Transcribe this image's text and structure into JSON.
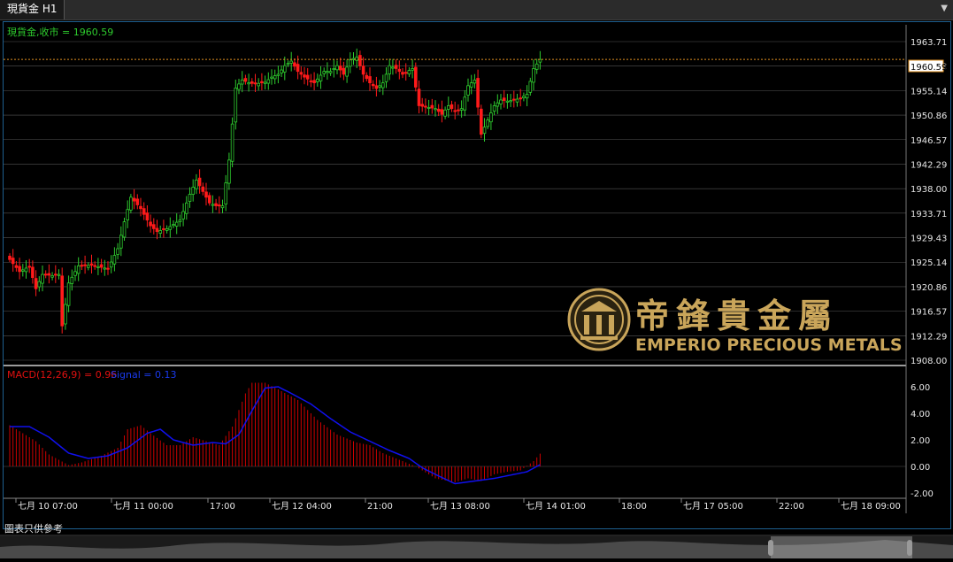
{
  "window": {
    "tab_title": "現貨金 H1"
  },
  "legend": {
    "price_label": "現貨金,收市 = 1960.59",
    "macd_label": "MACD(12,26,9) = 0.96",
    "signal_label": "Signal = 0.13"
  },
  "brand": {
    "cn": "帝鋒貴金屬",
    "en": "EMPERIO PRECIOUS METALS"
  },
  "footer": {
    "note": "圖表只供參考"
  },
  "colors": {
    "bull": "#2ecc2e",
    "bear": "#ff1a1a",
    "macd_hist": "#d00000",
    "signal": "#1010ee",
    "grid": "#555555",
    "last_price_line": "#e09020",
    "gold": "#c9a55a"
  },
  "chart_data": [
    {
      "type": "candlestick",
      "title": "現貨金 H1",
      "y_ticks": [
        "1963.71",
        "1959.43",
        "1955.14",
        "1950.86",
        "1946.57",
        "1942.29",
        "1938.00",
        "1933.71",
        "1929.43",
        "1925.14",
        "1920.86",
        "1916.57",
        "1912.29",
        "1908.00"
      ],
      "ylim": [
        1908.0,
        1963.71
      ],
      "x_tick_labels": [
        "七月 10 07:00",
        "七月 11 00:00",
        "17:00",
        "七月 12 04:00",
        "21:00",
        "七月 13 08:00",
        "七月 14 01:00",
        "18:00",
        "七月 17 05:00",
        "22:00",
        "七月 18 09:00"
      ],
      "last_price": 1960.59,
      "anchors": [
        [
          0,
          1925.6
        ],
        [
          3,
          1923.5
        ],
        [
          6,
          1924.4
        ],
        [
          8,
          1920.5
        ],
        [
          10,
          1923.0
        ],
        [
          13,
          1922.8
        ],
        [
          15,
          1923.0
        ],
        [
          16,
          1914.0
        ],
        [
          18,
          1921.5
        ],
        [
          21,
          1924.5
        ],
        [
          25,
          1924.6
        ],
        [
          30,
          1924.0
        ],
        [
          33,
          1927.5
        ],
        [
          35,
          1932.2
        ],
        [
          37,
          1936.5
        ],
        [
          40,
          1934.5
        ],
        [
          43,
          1931.5
        ],
        [
          45,
          1930.5
        ],
        [
          48,
          1931.0
        ],
        [
          52,
          1932.5
        ],
        [
          55,
          1937.0
        ],
        [
          57,
          1939.5
        ],
        [
          59,
          1937.5
        ],
        [
          61,
          1935.5
        ],
        [
          63,
          1935.0
        ],
        [
          65,
          1935.0
        ],
        [
          67,
          1943.0
        ],
        [
          69,
          1955.6
        ],
        [
          71,
          1957.0
        ],
        [
          73,
          1956.5
        ],
        [
          75,
          1956.3
        ],
        [
          78,
          1956.6
        ],
        [
          80,
          1957.5
        ],
        [
          82,
          1958.0
        ],
        [
          84,
          1959.5
        ],
        [
          86,
          1960.3
        ],
        [
          88,
          1958.5
        ],
        [
          90,
          1957.5
        ],
        [
          93,
          1956.5
        ],
        [
          96,
          1958.5
        ],
        [
          98,
          1958.5
        ],
        [
          100,
          1959.5
        ],
        [
          102,
          1958.0
        ],
        [
          104,
          1960.5
        ],
        [
          106,
          1961.0
        ],
        [
          108,
          1958.0
        ],
        [
          110,
          1956.5
        ],
        [
          112,
          1955.5
        ],
        [
          114,
          1956.5
        ],
        [
          116,
          1959.5
        ],
        [
          118,
          1959.0
        ],
        [
          120,
          1958.0
        ],
        [
          123,
          1959.0
        ],
        [
          125,
          1952.5
        ],
        [
          127,
          1952.3
        ],
        [
          130,
          1952.0
        ],
        [
          132,
          1951.0
        ],
        [
          134,
          1952.5
        ],
        [
          136,
          1951.5
        ],
        [
          138,
          1952.0
        ],
        [
          140,
          1956.0
        ],
        [
          142,
          1957.0
        ],
        [
          144,
          1947.5
        ],
        [
          146,
          1950.0
        ],
        [
          148,
          1952.5
        ],
        [
          150,
          1953.5
        ],
        [
          152,
          1953.3
        ],
        [
          154,
          1953.5
        ],
        [
          156,
          1953.8
        ],
        [
          158,
          1954.5
        ],
        [
          160,
          1959.0
        ],
        [
          162,
          1960.59
        ]
      ],
      "count": 163
    },
    {
      "type": "bar+line",
      "title": "MACD(12,26,9)",
      "y_ticks": [
        "6.00",
        "4.00",
        "2.00",
        "0.00",
        "-2.00"
      ],
      "ylim": [
        -2.0,
        6.0
      ],
      "macd_last": 0.96,
      "signal_last": 0.13,
      "macd_anchors": [
        [
          0,
          3.1
        ],
        [
          8,
          1.9
        ],
        [
          12,
          0.9
        ],
        [
          18,
          0.1
        ],
        [
          22,
          0.3
        ],
        [
          28,
          0.8
        ],
        [
          33,
          1.4
        ],
        [
          36,
          2.8
        ],
        [
          40,
          3.1
        ],
        [
          43,
          2.5
        ],
        [
          48,
          1.6
        ],
        [
          52,
          1.6
        ],
        [
          56,
          2.2
        ],
        [
          60,
          1.9
        ],
        [
          64,
          1.6
        ],
        [
          68,
          3.0
        ],
        [
          72,
          5.5
        ],
        [
          74,
          6.3
        ],
        [
          78,
          6.3
        ],
        [
          82,
          5.8
        ],
        [
          88,
          5.0
        ],
        [
          94,
          3.5
        ],
        [
          100,
          2.4
        ],
        [
          106,
          1.8
        ],
        [
          110,
          1.6
        ],
        [
          114,
          1.0
        ],
        [
          118,
          0.6
        ],
        [
          124,
          0.0
        ],
        [
          130,
          -0.9
        ],
        [
          136,
          -1.2
        ],
        [
          140,
          -0.9
        ],
        [
          144,
          -1.1
        ],
        [
          148,
          -0.6
        ],
        [
          152,
          -0.4
        ],
        [
          156,
          -0.3
        ],
        [
          160,
          0.4
        ],
        [
          162,
          0.96
        ]
      ],
      "signal_anchors": [
        [
          0,
          3.0
        ],
        [
          6,
          3.0
        ],
        [
          12,
          2.2
        ],
        [
          18,
          1.0
        ],
        [
          24,
          0.6
        ],
        [
          30,
          0.8
        ],
        [
          36,
          1.4
        ],
        [
          42,
          2.5
        ],
        [
          46,
          2.8
        ],
        [
          50,
          2.0
        ],
        [
          56,
          1.6
        ],
        [
          62,
          1.8
        ],
        [
          66,
          1.7
        ],
        [
          70,
          2.4
        ],
        [
          74,
          4.2
        ],
        [
          78,
          5.9
        ],
        [
          82,
          6.0
        ],
        [
          86,
          5.5
        ],
        [
          92,
          4.7
        ],
        [
          98,
          3.6
        ],
        [
          104,
          2.6
        ],
        [
          110,
          1.9
        ],
        [
          116,
          1.2
        ],
        [
          122,
          0.6
        ],
        [
          126,
          -0.1
        ],
        [
          130,
          -0.6
        ],
        [
          136,
          -1.3
        ],
        [
          142,
          -1.1
        ],
        [
          148,
          -0.9
        ],
        [
          154,
          -0.6
        ],
        [
          158,
          -0.4
        ],
        [
          162,
          0.13
        ]
      ]
    }
  ]
}
